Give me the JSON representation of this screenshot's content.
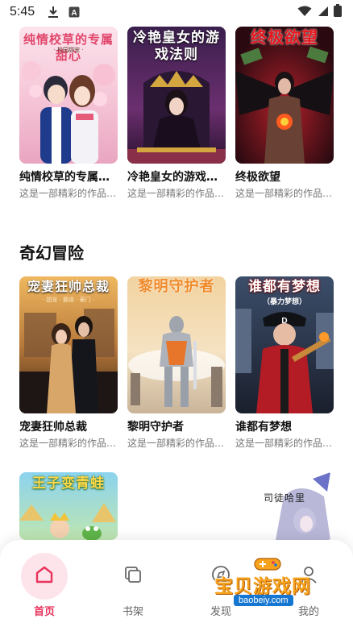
{
  "status_bar": {
    "time": "5:45",
    "icons": [
      "download-icon",
      "text-a-icon",
      "wifi-icon",
      "signal-icon",
      "battery-icon"
    ]
  },
  "rows": [
    {
      "books": [
        {
          "title": "纯情校草的专属甜心",
          "cover_title": "纯情校草的专属甜心",
          "cover_sub": "· 校园甜宠 ·",
          "description": "这是一部精彩的作品…"
        },
        {
          "title": "冷艳皇女的游戏法则",
          "cover_title": "冷艳皇女的游戏法则",
          "description": "这是一部精彩的作品…"
        },
        {
          "title": "终极欲望",
          "cover_title": "终极欲望",
          "description": "这是一部精彩的作品…"
        }
      ]
    }
  ],
  "section": {
    "title": "奇幻冒险",
    "books": [
      {
        "title": "宠妻狂帅总裁",
        "cover_title": "宠妻狂帅总裁",
        "cover_sub": "· 甜宠 · 霸道 · 豪门 ·",
        "description": "这是一部精彩的作品…"
      },
      {
        "title": "黎明守护者",
        "cover_title": "黎明守护者",
        "description": "这是一部精彩的作品…"
      },
      {
        "title": "谁都有梦想",
        "cover_title": "谁都有梦想",
        "cover_sub": "（暴力梦想）",
        "description": "这是一部精彩的作品…"
      }
    ],
    "partial_books": [
      {
        "cover_title": "王子变青蛙"
      },
      {
        "cover_title": "司徒哈里"
      }
    ]
  },
  "bottom_nav": {
    "items": [
      {
        "label": "首页",
        "icon": "home-icon",
        "active": true
      },
      {
        "label": "书架",
        "icon": "bookshelf-icon",
        "active": false
      },
      {
        "label": "发现",
        "icon": "discover-icon",
        "active": false
      },
      {
        "label": "我的",
        "icon": "profile-icon",
        "active": false
      }
    ]
  },
  "watermark": {
    "text": "宝贝游戏网",
    "url": "baobeiy.com"
  },
  "colors": {
    "accent": "#e8335c",
    "accent_bg": "#fde4ea",
    "title_text": "#111111",
    "desc_text": "#777777"
  }
}
